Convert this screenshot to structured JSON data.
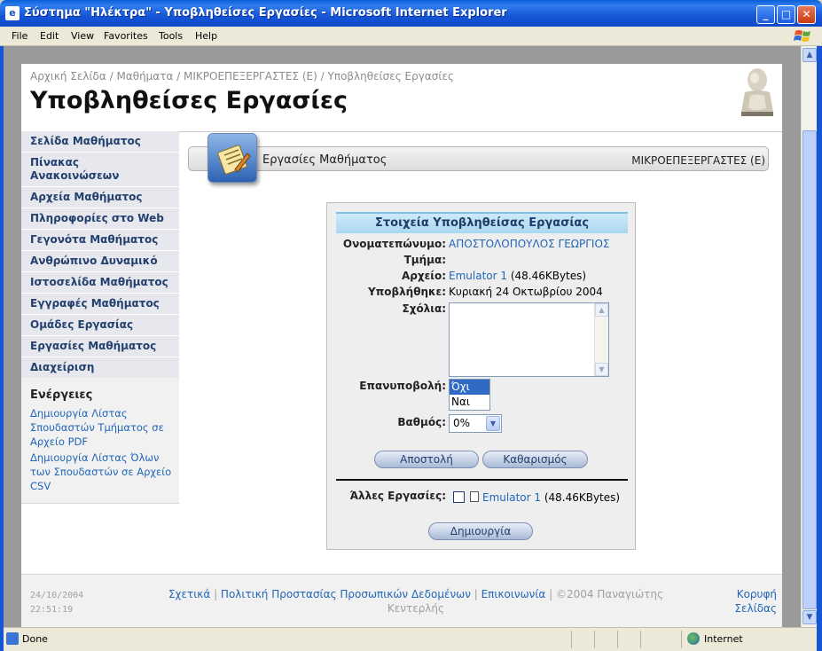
{
  "window": {
    "title": "Σύστημα \"Ηλέκτρα\" - Υποβληθείσες Εργασίες - Microsoft Internet Explorer",
    "minimize": "_",
    "maximize": "□",
    "close": "✕"
  },
  "menu": [
    "File",
    "Edit",
    "View",
    "Favorites",
    "Tools",
    "Help"
  ],
  "page": {
    "breadcrumb": "Αρχική Σελίδα / Μαθήματα / ΜΙΚΡΟΕΠΕΞΕΡΓΑΣΤΕΣ (Ε) / Υποβληθείσες Εργασίες",
    "title": "Υποβληθείσες Εργασίες"
  },
  "sidebar": {
    "items": [
      "Σελίδα Μαθήματος",
      "Πίνακας Ανακοινώσεων",
      "Αρχεία Μαθήματος",
      "Πληροφορίες στο Web",
      "Γεγονότα Μαθήματος",
      "Ανθρώπινο Δυναμικό",
      "Ιστοσελίδα Μαθήματος",
      "Εγγραφές Μαθήματος",
      "Ομάδες Εργασίας",
      "Εργασίες Μαθήματος",
      "Διαχείριση"
    ],
    "actions_title": "Ενέργειες",
    "actions": [
      "Δημιουργία Λίστας Σπουδαστών Τμήματος σε Αρχείο PDF",
      "Δημιουργία Λίστας Όλων των Σπουδαστών σε Αρχείο CSV"
    ]
  },
  "section": {
    "title": "Εργασίες Μαθήματος",
    "course": "ΜΙΚΡΟΕΠΕΞΕΡΓΑΣΤΕΣ (Ε)"
  },
  "form": {
    "header": "Στοιχεία Υποβληθείσας Εργασίας",
    "name_label": "Ονοματεπώνυμο:",
    "name_value": "ΑΠΟΣΤΟΛΟΠΟΥΛΟΣ ΓΕΩΡΓΙΟΣ",
    "dept_label": "Τμήμα:",
    "file_label": "Αρχείο:",
    "file_name": "Emulator 1",
    "file_size": " (48.46KBytes)",
    "submitted_label": "Υποβλήθηκε:",
    "submitted_value": "Κυριακή 24 Οκτωβρίου 2004",
    "comments_label": "Σχόλια:",
    "resubmit_label": "Επανυποβολή:",
    "resubmit_options": [
      "Όχι",
      "Ναι"
    ],
    "grade_label": "Βαθμός:",
    "grade_value": "0%",
    "submit_button": "Αποστολή",
    "clear_button": "Καθαρισμός",
    "other_label": "Άλλες Εργασίες:",
    "other_file_name": "Emulator 1",
    "other_file_size": " (48.46KBytes)",
    "create_button": "Δημιουργία"
  },
  "footer": {
    "date": "24/10/2004",
    "time": "22:51:19",
    "links": [
      "Σχετικά",
      "Πολιτική Προστασίας Προσωπικών Δεδομένων",
      "Επικοινωνία"
    ],
    "copyright": "©2004 Παναγιώτης Κεντερλής",
    "top_link": "Κορυφή Σελίδας"
  },
  "status": {
    "text": "Done",
    "zone": "Internet"
  }
}
